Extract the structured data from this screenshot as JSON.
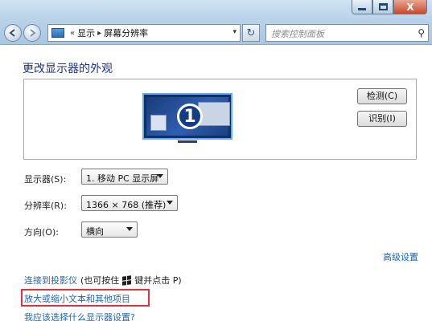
{
  "window_controls": {
    "minimize_icon": "minimize-icon",
    "maximize_icon": "maximize-icon",
    "close_label": "X"
  },
  "address_bar": {
    "overflow": "«",
    "crumbs": [
      "显示",
      "屏幕分辨率"
    ],
    "separator": "▸",
    "dropdown": "▾",
    "refresh": "↻"
  },
  "search": {
    "placeholder": "搜索控制面板",
    "icon": "⚲"
  },
  "page": {
    "title": "更改显示器的外观"
  },
  "preview": {
    "monitor_number": "1",
    "detect_button": "检测(C)",
    "identify_button": "识别(I)"
  },
  "settings": {
    "display": {
      "label": "显示器(S):",
      "value": "1. 移动 PC 显示屏"
    },
    "resolution": {
      "label": "分辨率(R):",
      "value": "1366 × 768 (推荐)"
    },
    "orientation": {
      "label": "方向(O):",
      "value": "横向"
    }
  },
  "links": {
    "advanced": "高级设置",
    "projector": "连接到投影仪",
    "projector_hint_prefix": "(也可按住",
    "projector_hint_suffix": "键并点击 P)",
    "text_size": "放大或缩小文本和其他项目",
    "which_settings": "我应该选择什么显示器设置?"
  },
  "colors": {
    "link": "#1e64b4",
    "title": "#1e3287",
    "highlight": "#e0323a"
  }
}
